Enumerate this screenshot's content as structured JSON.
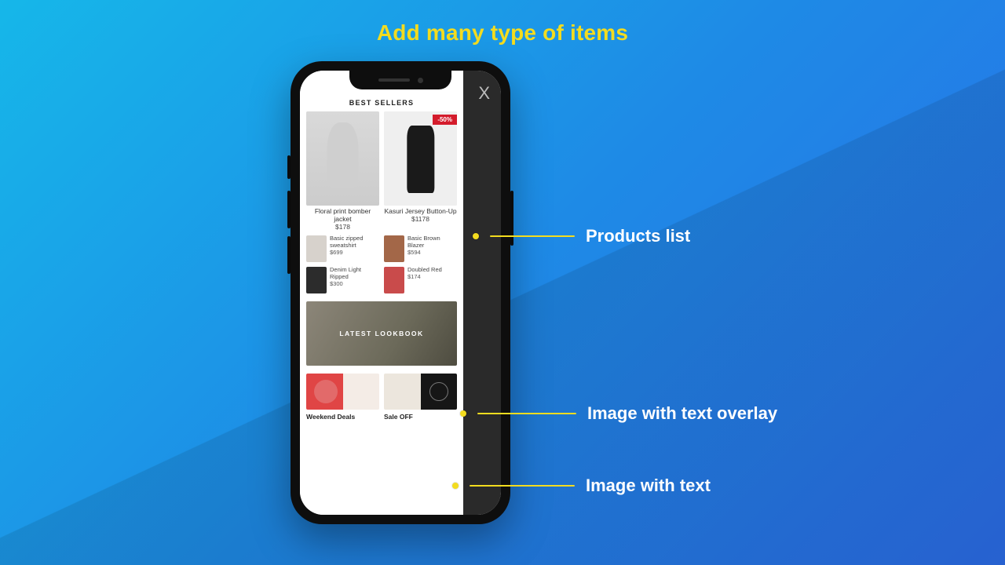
{
  "title": "Add many type of items",
  "callouts": {
    "products_list": "Products list",
    "image_overlay": "Image with text overlay",
    "image_text": "Image with text"
  },
  "app": {
    "close": "X",
    "best_sellers": "BEST SELLERS",
    "badge_50": "-50%",
    "featured": [
      {
        "name": "Floral print bomber jacket",
        "price": "$178"
      },
      {
        "name": "Kasuri Jersey Button-Up",
        "price": "$1178"
      }
    ],
    "mini": [
      {
        "name": "Basic zipped sweatshirt",
        "price": "$699"
      },
      {
        "name": "Basic Brown Blazer",
        "price": "$594"
      },
      {
        "name": "Denim Light Ripped",
        "price": "$300"
      },
      {
        "name": "Doubled Red",
        "price": "$174"
      }
    ],
    "lookbook": "LATEST LOOKBOOK",
    "bottom": [
      {
        "label": "Weekend Deals"
      },
      {
        "label": "Sale OFF"
      }
    ]
  }
}
